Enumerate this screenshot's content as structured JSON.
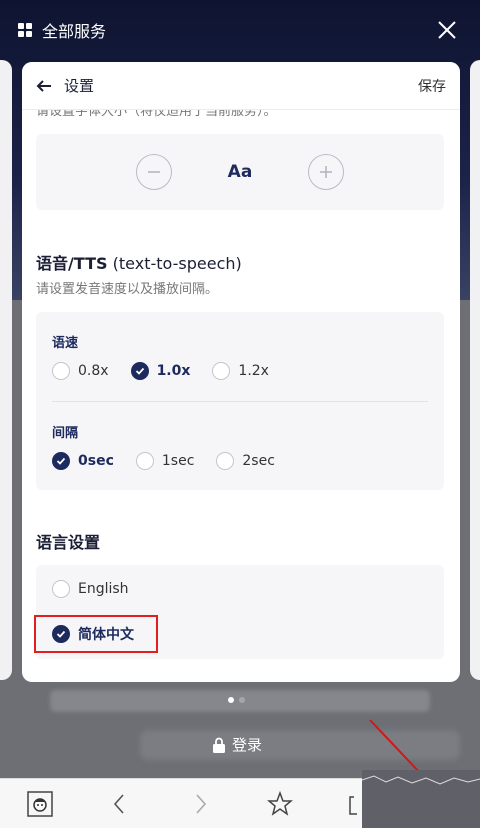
{
  "topbar": {
    "title": "全部服务"
  },
  "settings": {
    "title": "设置",
    "save": "保存",
    "font_desc_cut": "请设置字体大小（将仅适用于当前服务）。",
    "font_label": "Aa",
    "tts": {
      "title": "语音/TTS",
      "title_sub": " (text-to-speech)",
      "desc": "请设置发音速度以及播放间隔。",
      "speed_label": "语速",
      "speed_options": [
        "0.8x",
        "1.0x",
        "1.2x"
      ],
      "speed_selected": "1.0x",
      "interval_label": "间隔",
      "interval_options": [
        "0sec",
        "1sec",
        "2sec"
      ],
      "interval_selected": "0sec"
    },
    "language": {
      "title": "语言设置",
      "options": [
        "English",
        "简体中文"
      ],
      "selected": "简体中文"
    }
  },
  "login": "登录",
  "colors": {
    "accent": "#1d2a5e",
    "highlight": "#e02020"
  }
}
